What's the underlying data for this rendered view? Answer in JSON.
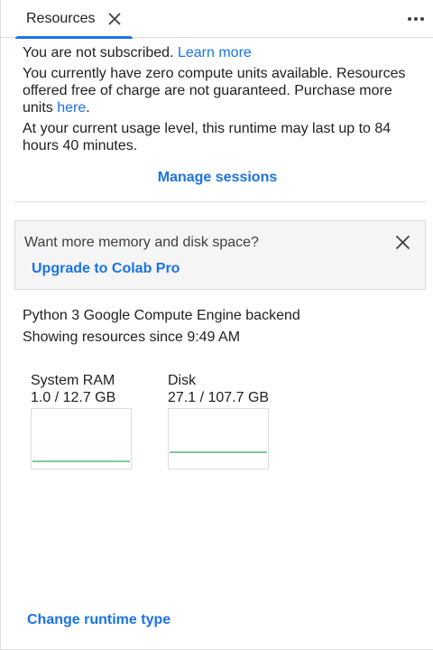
{
  "tab": {
    "label": "Resources",
    "close_icon": "close-icon",
    "more_icon": "more-vert-icon"
  },
  "subscription": {
    "status_text": "You are not subscribed.",
    "learn_more": "Learn more",
    "compute_text": "You currently have zero compute units available. Resources offered free of charge are not guaranteed. Purchase more units",
    "here_link": "here",
    "here_suffix": ".",
    "runtime_text": "At your current usage level, this runtime may last up to 84 hours 40 minutes."
  },
  "manage_sessions": "Manage sessions",
  "upsell": {
    "text": "Want more memory and disk space?",
    "link": "Upgrade to Colab Pro",
    "close_icon": "close-icon"
  },
  "backend": {
    "name": "Python 3 Google Compute Engine backend",
    "since": "Showing resources since 9:49 AM"
  },
  "gauges": [
    {
      "title": "System RAM",
      "value": "1.0 / 12.7 GB",
      "used": 1.0,
      "total": 12.7
    },
    {
      "title": "Disk",
      "value": "27.1 / 107.7 GB",
      "used": 27.1,
      "total": 107.7
    }
  ],
  "change_runtime": "Change runtime type",
  "colors": {
    "accent": "#1a73e8",
    "gauge_line": "#81c995",
    "border": "#dadce0"
  }
}
